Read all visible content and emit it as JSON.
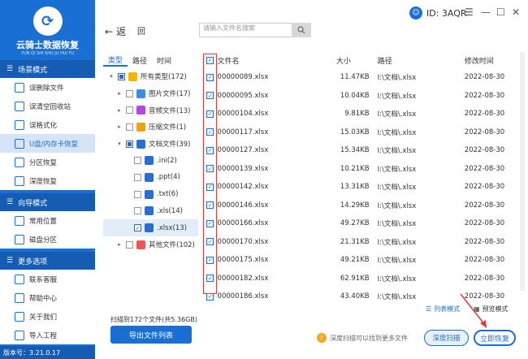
{
  "app": {
    "logo_text": "云骑士数据恢复",
    "logo_sub": "YUN QI SHI SHU JU HUI FU",
    "version": "版本号：3.21.0.17"
  },
  "sidebar": {
    "sections": [
      {
        "title": "场景模式",
        "items": [
          {
            "label": "误删除文件",
            "active": false
          },
          {
            "label": "误清空回收站",
            "active": false
          },
          {
            "label": "误格式化",
            "active": false
          },
          {
            "label": "U盘/内存卡恢复",
            "active": true
          },
          {
            "label": "分区恢复",
            "active": false
          },
          {
            "label": "深度恢复",
            "active": false
          }
        ]
      },
      {
        "title": "向导模式",
        "items": [
          {
            "label": "常用位置",
            "active": false
          },
          {
            "label": "磁盘分区",
            "active": false
          }
        ]
      },
      {
        "title": "更多选项",
        "items": [
          {
            "label": "联系客服",
            "active": false
          },
          {
            "label": "帮助中心",
            "active": false
          },
          {
            "label": "关于我们",
            "active": false
          },
          {
            "label": "导入工程",
            "active": false
          }
        ]
      }
    ]
  },
  "topbar": {
    "back_label": "返",
    "home_label": "回",
    "search_placeholder": "请输入文件名搜索",
    "id_label": "ID: 3AQR"
  },
  "tree": {
    "tabs": [
      "类型",
      "路径",
      "时间"
    ],
    "rows": [
      {
        "indent": 0,
        "arrow": "▾",
        "label": "所有类型(172)",
        "check": "part",
        "icon_color": "#f5b400",
        "selected": false
      },
      {
        "indent": 1,
        "arrow": "▸",
        "label": "图片文件(17)",
        "check": "off",
        "icon_color": "#3b8de0",
        "selected": false
      },
      {
        "indent": 1,
        "arrow": "▸",
        "label": "音频文件(13)",
        "check": "off",
        "icon_color": "#b04ad8",
        "selected": false
      },
      {
        "indent": 1,
        "arrow": "▸",
        "label": "压缩文件(1)",
        "check": "off",
        "icon_color": "#e8a21c",
        "selected": false
      },
      {
        "indent": 1,
        "arrow": "▾",
        "label": "文档文件(39)",
        "check": "part",
        "icon_color": "#2a6fd0",
        "selected": false
      },
      {
        "indent": 2,
        "arrow": "",
        "label": ".ini(2)",
        "check": "off",
        "icon_color": "#2a6fd0",
        "selected": false
      },
      {
        "indent": 2,
        "arrow": "",
        "label": ".ppt(4)",
        "check": "off",
        "icon_color": "#2a6fd0",
        "selected": false
      },
      {
        "indent": 2,
        "arrow": "",
        "label": ".txt(6)",
        "check": "off",
        "icon_color": "#2a6fd0",
        "selected": false
      },
      {
        "indent": 2,
        "arrow": "",
        "label": ".xls(14)",
        "check": "off",
        "icon_color": "#2a6fd0",
        "selected": false
      },
      {
        "indent": 2,
        "arrow": "",
        "label": ".xlsx(13)",
        "check": "on",
        "icon_color": "#2a6fd0",
        "selected": true
      },
      {
        "indent": 1,
        "arrow": "▸",
        "label": "其他文件(102)",
        "check": "off",
        "icon_color": "#e85a5a",
        "selected": false
      }
    ]
  },
  "list": {
    "headers": {
      "name": "文件名",
      "size": "大小",
      "path": "路径",
      "date": "修改时间"
    },
    "rows": [
      {
        "name": "00000089.xlsx",
        "size": "11.47KB",
        "path": "I:\\文档\\.xlsx",
        "date": "2022-08-30"
      },
      {
        "name": "00000095.xlsx",
        "size": "10.04KB",
        "path": "I:\\文档\\.xlsx",
        "date": "2022-08-30"
      },
      {
        "name": "00000104.xlsx",
        "size": "9.81KB",
        "path": "I:\\文档\\.xlsx",
        "date": "2022-08-30"
      },
      {
        "name": "00000117.xlsx",
        "size": "15.03KB",
        "path": "I:\\文档\\.xlsx",
        "date": "2022-08-30"
      },
      {
        "name": "00000127.xlsx",
        "size": "15.34KB",
        "path": "I:\\文档\\.xlsx",
        "date": "2022-08-30"
      },
      {
        "name": "00000139.xlsx",
        "size": "10.21KB",
        "path": "I:\\文档\\.xlsx",
        "date": "2022-08-30"
      },
      {
        "name": "00000142.xlsx",
        "size": "13.31KB",
        "path": "I:\\文档\\.xlsx",
        "date": "2022-08-30"
      },
      {
        "name": "00000146.xlsx",
        "size": "14.29KB",
        "path": "I:\\文档\\.xlsx",
        "date": "2022-08-30"
      },
      {
        "name": "00000166.xlsx",
        "size": "49.27KB",
        "path": "I:\\文档\\.xlsx",
        "date": "2022-08-30"
      },
      {
        "name": "00000170.xlsx",
        "size": "21.31KB",
        "path": "I:\\文档\\.xlsx",
        "date": "2022-08-30"
      },
      {
        "name": "00000175.xlsx",
        "size": "49.21KB",
        "path": "I:\\文档\\.xlsx",
        "date": "2022-08-30"
      },
      {
        "name": "00000182.xlsx",
        "size": "62.91KB",
        "path": "I:\\文档\\.xlsx",
        "date": "2022-08-30"
      },
      {
        "name": "00000186.xlsx",
        "size": "43.40KB",
        "path": "I:\\文档\\.xlsx",
        "date": "2022-08-30"
      }
    ]
  },
  "bottom": {
    "scan_info": "扫描到172个文件(共5.36GB)",
    "export_label": "导出文件列表",
    "list_view_label": "列表模式",
    "preview_view_label": "预览模式",
    "warn_text": "深度扫描可以找到更多文件",
    "deep_scan_label": "深度扫描",
    "recover_label": "立即恢复"
  },
  "colors": {
    "brand": "#1a6fd4",
    "highlight": "#e33333"
  }
}
